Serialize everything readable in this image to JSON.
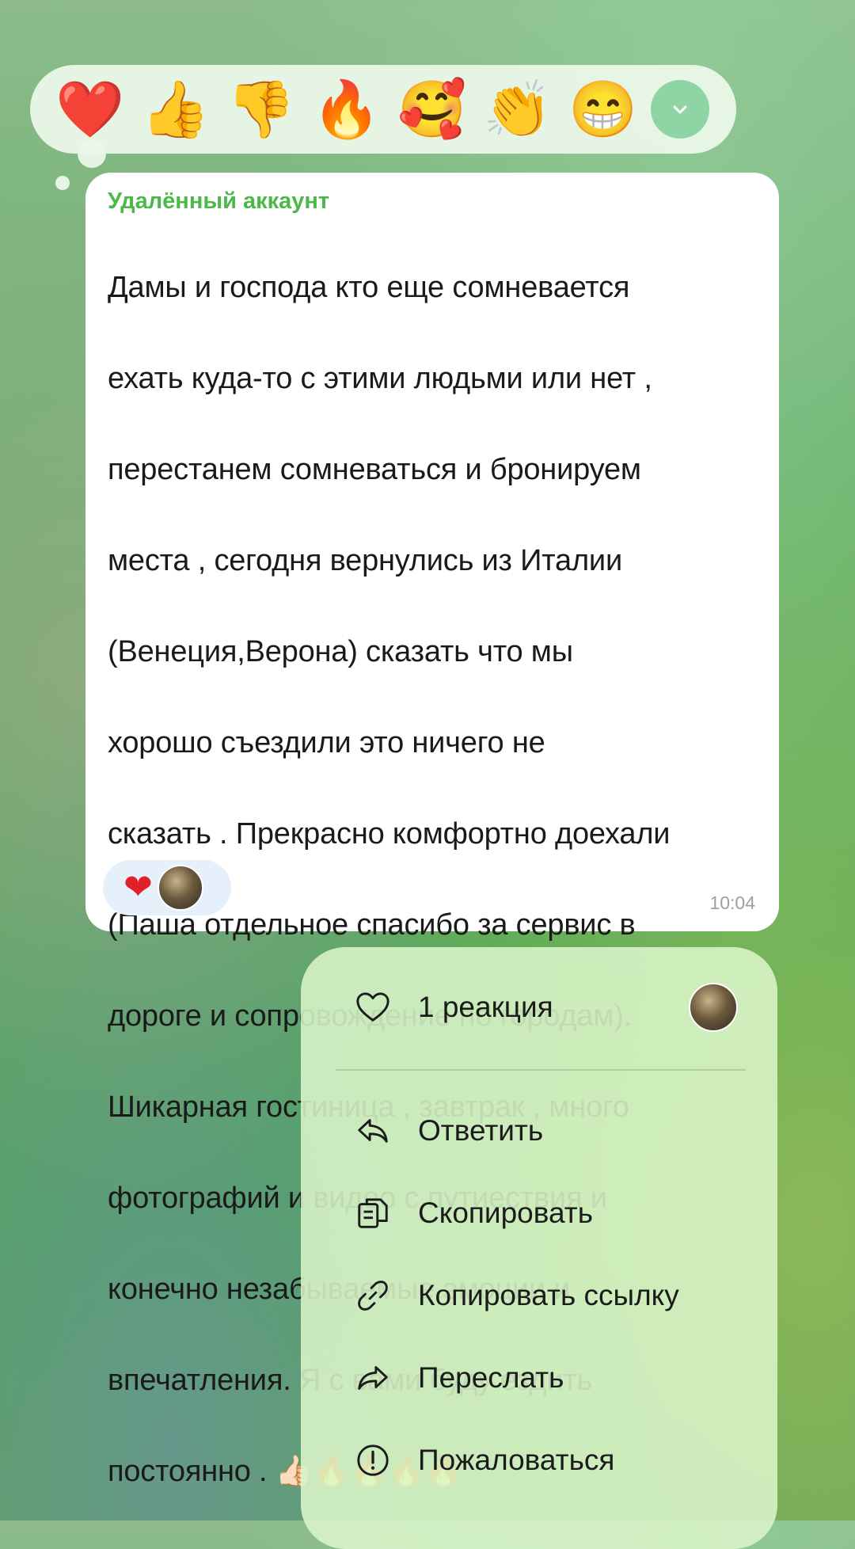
{
  "reaction_bar": {
    "emojis": [
      {
        "char": "❤️",
        "icon": "red-heart"
      },
      {
        "char": "👍",
        "icon": "thumbs-up"
      },
      {
        "char": "👎",
        "icon": "thumbs-down"
      },
      {
        "char": "🔥",
        "icon": "fire"
      },
      {
        "char": "🥰",
        "icon": "smiling-face-with-hearts"
      },
      {
        "char": "👏",
        "icon": "clapping-hands"
      },
      {
        "char": "😁",
        "icon": "grinning-face"
      }
    ],
    "expand_icon": "chevron-down-icon"
  },
  "message": {
    "sender": "Удалённый аккаунт",
    "lines": [
      "Дамы и господа кто еще сомневается",
      "ехать куда-то с этими людьми или нет ,",
      "перестанем сомневаться и бронируем",
      "места , сегодня вернулись из Италии",
      "(Венеция,Верона) сказать что мы",
      "хорошо съездили это ничего не",
      "сказать . Прекрасно комфортно доехали",
      "(Паша отдельное спасибо за сервис в",
      "дороге и сопровождение по городам).",
      "Шикарная гостиница , завтрак , много",
      "фотографий и видео с путиествия и",
      "конечно незабываемые эмоции и",
      "впечатления. Я с вами буду ездить",
      "постоянно . 👍🏻🔥🔥🔥🔥"
    ],
    "reaction": "❤",
    "time": "10:04"
  },
  "menu": {
    "reactions_label": "1 реакция",
    "items": [
      {
        "label": "Ответить",
        "icon": "reply-icon"
      },
      {
        "label": "Скопировать",
        "icon": "copy-icon"
      },
      {
        "label": "Копировать ссылку",
        "icon": "link-icon"
      },
      {
        "label": "Переслать",
        "icon": "forward-icon"
      },
      {
        "label": "Пожаловаться",
        "icon": "report-icon"
      }
    ]
  },
  "colors": {
    "sender": "#4cb848",
    "expand_button": "#8fd4a4",
    "chip_heart": "#e0202a"
  }
}
